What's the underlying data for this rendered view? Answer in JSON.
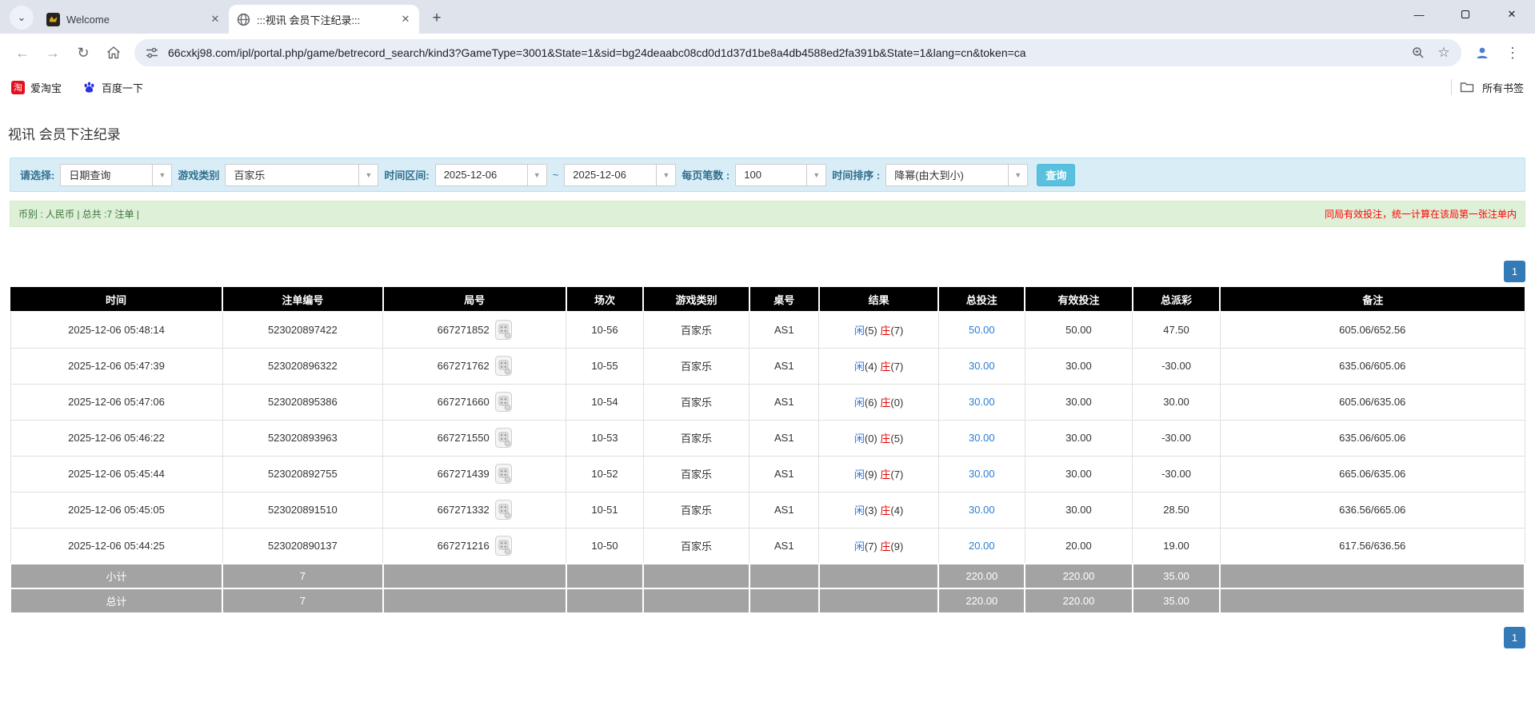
{
  "browser": {
    "tabs": [
      {
        "title": "Welcome"
      },
      {
        "title": ":::视讯 会员下注纪录:::"
      }
    ],
    "url": "66cxkj98.com/ipl/portal.php/game/betrecord_search/kind3?GameType=3001&State=1&sid=bg24deaabc08cd0d1d37d1be8a4db4588ed2fa391b&State=1&lang=cn&token=ca",
    "bookmarks": {
      "item1": "爱淘宝",
      "item2": "百度一下",
      "all_label": "所有书签"
    }
  },
  "page": {
    "title": "视讯 会员下注纪录",
    "filters": {
      "query_type": {
        "label": "请选择:",
        "value": "日期查询"
      },
      "game_category": {
        "label": "游戏类别",
        "value": "百家乐"
      },
      "date_range": {
        "label": "时间区间:",
        "from": "2025-12-06",
        "separator": "~",
        "to": "2025-12-06"
      },
      "page_size": {
        "label": "每页笔数 :",
        "value": "100"
      },
      "time_sort": {
        "label": "时间排序 :",
        "value": "降幂(由大到小)"
      },
      "search_label": "查询"
    },
    "summary": {
      "left": "币别 : 人民币 | 总共 :7 注单 |",
      "right": "同局有效投注，统一计算在该局第一张注单内"
    },
    "pagination": {
      "page": "1"
    },
    "table": {
      "headers": [
        "时间",
        "注单编号",
        "局号",
        "场次",
        "游戏类别",
        "桌号",
        "结果",
        "总投注",
        "有效投注",
        "总派彩",
        "备注"
      ],
      "rows": [
        {
          "time": "2025-12-06 05:48:14",
          "bet_no": "523020897422",
          "round_no": "667271852",
          "session": "10-56",
          "game": "百家乐",
          "table_no": "AS1",
          "result": {
            "player_label": "闲",
            "player_points": "(5)",
            "banker_label": "庄",
            "banker_points": "(7)"
          },
          "total_bet": "50.00",
          "valid_bet": "50.00",
          "payout": "47.50",
          "payout_neg": false,
          "remark": "605.06/652.56"
        },
        {
          "time": "2025-12-06 05:47:39",
          "bet_no": "523020896322",
          "round_no": "667271762",
          "session": "10-55",
          "game": "百家乐",
          "table_no": "AS1",
          "result": {
            "player_label": "闲",
            "player_points": "(4)",
            "banker_label": "庄",
            "banker_points": "(7)"
          },
          "total_bet": "30.00",
          "valid_bet": "30.00",
          "payout": "-30.00",
          "payout_neg": true,
          "remark": "635.06/605.06"
        },
        {
          "time": "2025-12-06 05:47:06",
          "bet_no": "523020895386",
          "round_no": "667271660",
          "session": "10-54",
          "game": "百家乐",
          "table_no": "AS1",
          "result": {
            "player_label": "闲",
            "player_points": "(6)",
            "banker_label": "庄",
            "banker_points": "(0)"
          },
          "total_bet": "30.00",
          "valid_bet": "30.00",
          "payout": "30.00",
          "payout_neg": false,
          "remark": "605.06/635.06"
        },
        {
          "time": "2025-12-06 05:46:22",
          "bet_no": "523020893963",
          "round_no": "667271550",
          "session": "10-53",
          "game": "百家乐",
          "table_no": "AS1",
          "result": {
            "player_label": "闲",
            "player_points": "(0)",
            "banker_label": "庄",
            "banker_points": "(5)"
          },
          "total_bet": "30.00",
          "valid_bet": "30.00",
          "payout": "-30.00",
          "payout_neg": true,
          "remark": "635.06/605.06"
        },
        {
          "time": "2025-12-06 05:45:44",
          "bet_no": "523020892755",
          "round_no": "667271439",
          "session": "10-52",
          "game": "百家乐",
          "table_no": "AS1",
          "result": {
            "player_label": "闲",
            "player_points": "(9)",
            "banker_label": "庄",
            "banker_points": "(7)"
          },
          "total_bet": "30.00",
          "valid_bet": "30.00",
          "payout": "-30.00",
          "payout_neg": true,
          "remark": "665.06/635.06"
        },
        {
          "time": "2025-12-06 05:45:05",
          "bet_no": "523020891510",
          "round_no": "667271332",
          "session": "10-51",
          "game": "百家乐",
          "table_no": "AS1",
          "result": {
            "player_label": "闲",
            "player_points": "(3)",
            "banker_label": "庄",
            "banker_points": "(4)"
          },
          "total_bet": "30.00",
          "valid_bet": "30.00",
          "payout": "28.50",
          "payout_neg": false,
          "remark": "636.56/665.06"
        },
        {
          "time": "2025-12-06 05:44:25",
          "bet_no": "523020890137",
          "round_no": "667271216",
          "session": "10-50",
          "game": "百家乐",
          "table_no": "AS1",
          "result": {
            "player_label": "闲",
            "player_points": "(7)",
            "banker_label": "庄",
            "banker_points": "(9)"
          },
          "total_bet": "20.00",
          "valid_bet": "20.00",
          "payout": "19.00",
          "payout_neg": false,
          "remark": "617.56/636.56"
        }
      ],
      "footer": [
        {
          "label": "小计",
          "count": "7",
          "total_bet": "220.00",
          "valid_bet": "220.00",
          "payout": "35.00"
        },
        {
          "label": "总计",
          "count": "7",
          "total_bet": "220.00",
          "valid_bet": "220.00",
          "payout": "35.00"
        }
      ]
    }
  },
  "colors": {
    "accent_blue": "#337ab7",
    "search_button_blue": "#5bc0de",
    "player_blue": "#2f6fd2",
    "banker_red": "#e00000",
    "negative_red": "#ff0000",
    "filter_bg": "#d9edf7",
    "summary_bg": "#dff0d8",
    "table_header_bg": "#000000",
    "table_footer_bg": "#a3a3a3"
  }
}
